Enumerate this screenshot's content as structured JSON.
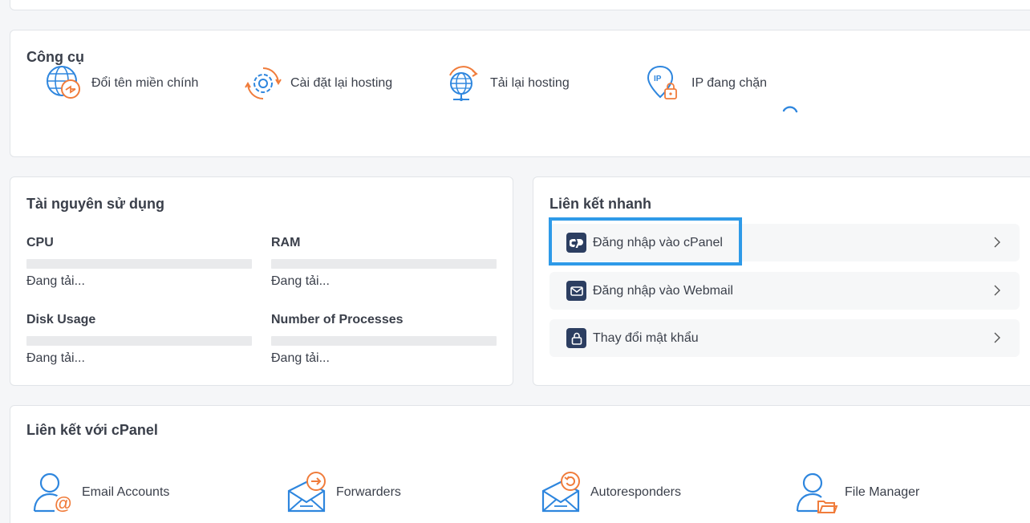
{
  "tools": {
    "title": "Công cụ",
    "items": [
      {
        "label": "Đổi tên miền chính",
        "icon": "globe-swap-icon"
      },
      {
        "label": "Cài đặt lại hosting",
        "icon": "gear-refresh-icon"
      },
      {
        "label": "Tải lại hosting",
        "icon": "globe-reload-icon"
      },
      {
        "label": "IP đang chặn",
        "icon": "ip-pin-lock-icon"
      }
    ]
  },
  "resources": {
    "title": "Tài nguyên sử dụng",
    "items": [
      {
        "label": "CPU",
        "status": "Đang tải..."
      },
      {
        "label": "RAM",
        "status": "Đang tải..."
      },
      {
        "label": "Disk Usage",
        "status": "Đang tải..."
      },
      {
        "label": "Number of Processes",
        "status": "Đang tải..."
      }
    ]
  },
  "quick_links": {
    "title": "Liên kết nhanh",
    "items": [
      {
        "label": "Đăng nhập vào cPanel",
        "icon": "cpanel-icon"
      },
      {
        "label": "Đăng nhập vào Webmail",
        "icon": "envelope-icon"
      },
      {
        "label": "Thay đổi mật khẩu",
        "icon": "lock-icon"
      }
    ]
  },
  "cpanel_links": {
    "title": "Liên kết với cPanel",
    "items": [
      {
        "label": "Email Accounts",
        "icon": "user-email-icon"
      },
      {
        "label": "Forwarders",
        "icon": "mail-forward-icon"
      },
      {
        "label": "Autoresponders",
        "icon": "mail-autoresponder-icon"
      },
      {
        "label": "File Manager",
        "icon": "user-folder-icon"
      }
    ]
  },
  "colors": {
    "accent_blue": "#2e86de",
    "accent_orange": "#f07c3b",
    "dark_navy": "#2c3e61",
    "highlight": "#2e9ae8"
  }
}
